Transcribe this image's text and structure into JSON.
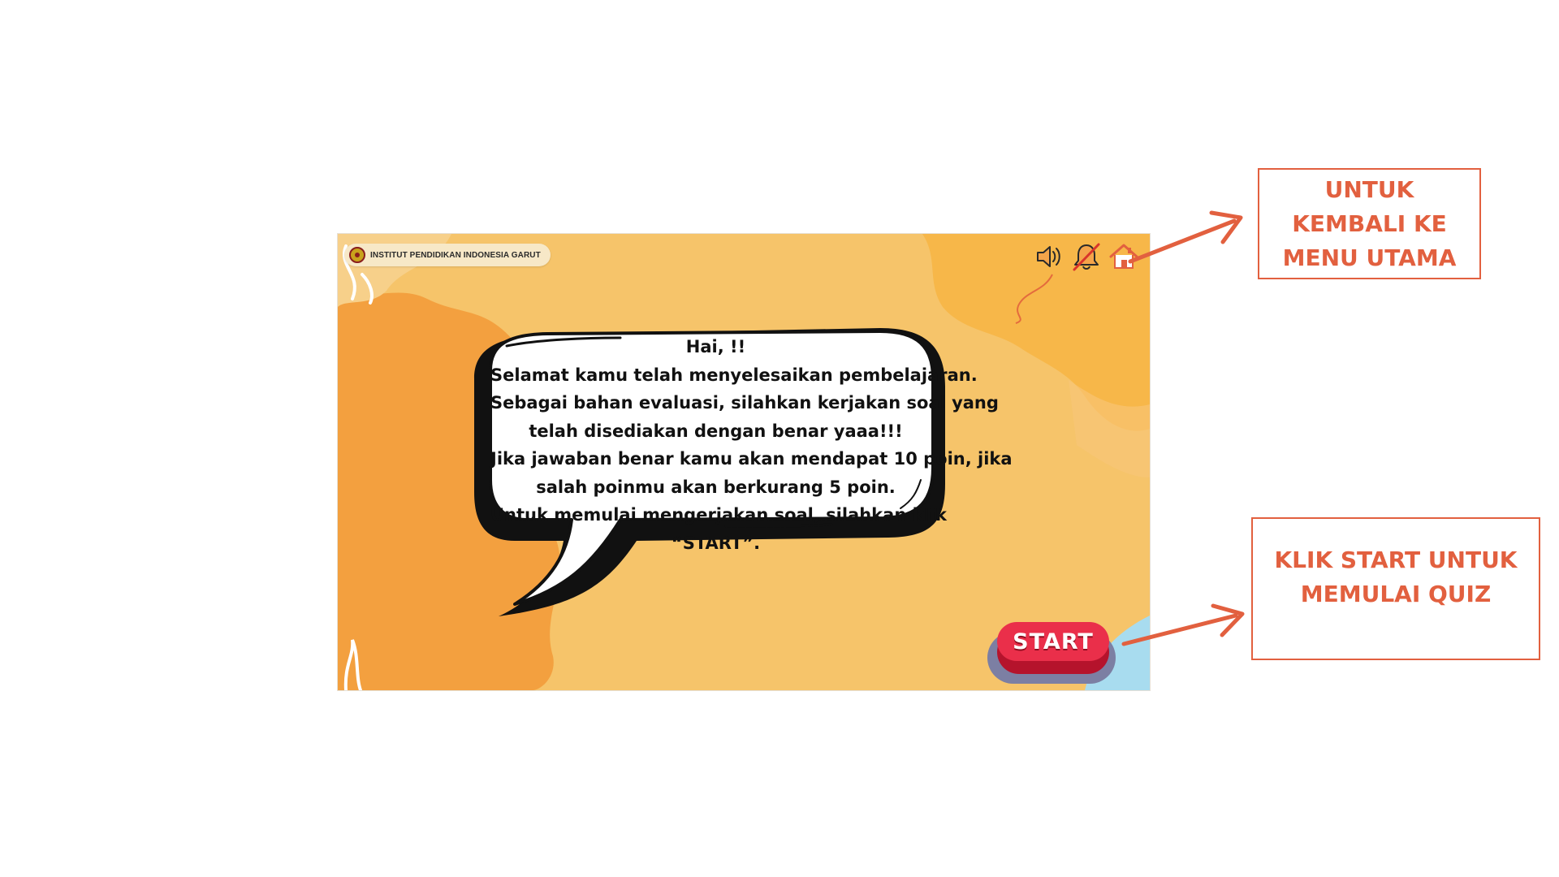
{
  "game": {
    "institution_name": "INSTITUT PENDIDIKAN INDONESIA GARUT",
    "icons": {
      "sound": "speaker-icon",
      "notification_muted": "bell-off-icon",
      "home": "home-icon"
    },
    "bubble_lines": [
      "Hai, !!",
      "Selamat kamu telah menyelesaikan pembelajaran.",
      "Sebagai bahan evaluasi, silahkan kerjakan soal yang",
      "telah disediakan dengan benar yaaa!!!",
      "Jika jawaban benar kamu akan mendapat 10 poin, jika",
      "salah poinmu akan berkurang 5 poin.",
      "Untuk memulai mengerjakan soal, silahkan klik",
      "“START”."
    ],
    "start_label": "START"
  },
  "annotations": {
    "home_callout_lines": [
      "UNTUK",
      "KEMBALI KE",
      "MENU UTAMA"
    ],
    "start_callout_lines": [
      "KLIK  START UNTUK",
      "MEMULAI QUIZ"
    ]
  },
  "colors": {
    "annotation": "#e2603f",
    "game_bg_light": "#f5c56a",
    "game_bg_dark": "#f29c3f",
    "start_button": "#ea2f4a"
  }
}
